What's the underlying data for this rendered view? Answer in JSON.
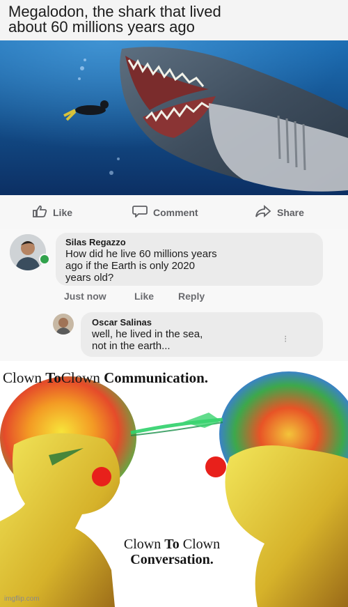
{
  "post": {
    "caption_line1": "Megalodon, the shark that lived",
    "caption_line2": "about 60 millions years ago"
  },
  "actions": {
    "like": "Like",
    "comment": "Comment",
    "share": "Share"
  },
  "comments": [
    {
      "name": "Silas Regazzo",
      "text_line1": "How did he live 60 millions years",
      "text_line2": "ago if the Earth is only 2020",
      "text_line3": "years old?",
      "meta_time": "Just now",
      "meta_like": "Like",
      "meta_reply": "Reply"
    },
    {
      "name": "Oscar Salinas",
      "text_line1": "well, he lived in the sea,",
      "text_line2": "not in the earth..."
    }
  ],
  "meme": {
    "top_line_a": "Clown",
    "top_line_b": "To",
    "top_line_c": "Clown",
    "top_line_d": "Communication.",
    "bottom_line_a": "Clown",
    "bottom_line_b": "To",
    "bottom_line_c": "Clown",
    "bottom_line_d": "Conversation."
  },
  "watermark": "imgflip.com",
  "colors": {
    "clown_nose": "#e8201b",
    "facebook_gray": "#5f6064",
    "sea_blue": "#14528f"
  }
}
